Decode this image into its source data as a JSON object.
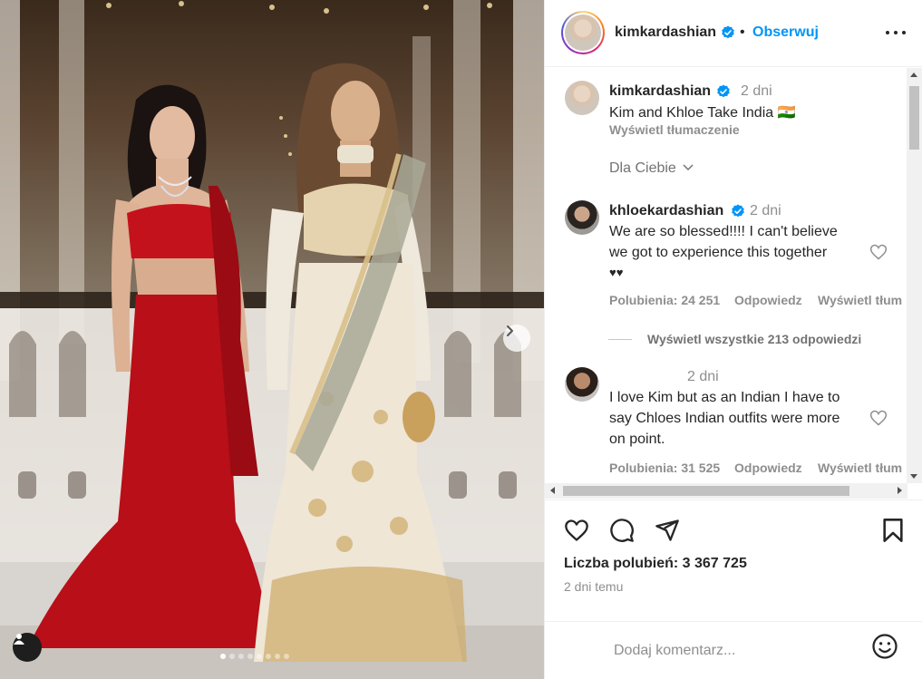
{
  "post": {
    "username": "kimkardashian",
    "follow_label": "Obserwuj",
    "separator": "•"
  },
  "caption": {
    "username": "kimkardashian",
    "time": "2 dni",
    "text": "Kim and Khloe Take India 🇮🇳",
    "translate_label": "Wyświetl tłumaczenie"
  },
  "for_you_label": "Dla Ciebie",
  "comments": [
    {
      "username": "khloekardashian",
      "time": "2 dni",
      "lines": [
        "We are so blessed!!!! I can't believe",
        "we got to experience this together",
        "♥♥"
      ],
      "likes_label": "Polubienia: 24 251",
      "reply_label": "Odpowiedz",
      "translate_label": "Wyświetl tłum"
    },
    {
      "username": "",
      "time": "2 dni",
      "lines": [
        "I love Kim but as an Indian I have to",
        "say Chloes Indian outfits were more",
        "on point."
      ],
      "likes_label": "Polubienia: 31 525",
      "reply_label": "Odpowiedz",
      "translate_label": "Wyświetl tłum"
    }
  ],
  "view_replies_label": "Wyświetl wszystkie 213 odpowiedzi",
  "likes_count_label": "Liczba polubień: 3 367 725",
  "date_label": "2 dni temu",
  "add_comment_placeholder": "Dodaj komentarz...",
  "carousel": {
    "slide_count": 8,
    "active_index": 0
  },
  "colors": {
    "accent": "#0095f6",
    "text": "#262626",
    "muted": "#8e8e8e"
  },
  "icons": {
    "next": "chevron-right-icon",
    "user_tag": "person-icon",
    "more": "more-horizontal-icon",
    "verified": "verified-badge-icon",
    "like": "heart-icon",
    "comment": "comment-icon",
    "share": "send-icon",
    "save": "bookmark-icon",
    "emoji": "emoji-icon",
    "chevron": "chevron-down-icon"
  }
}
